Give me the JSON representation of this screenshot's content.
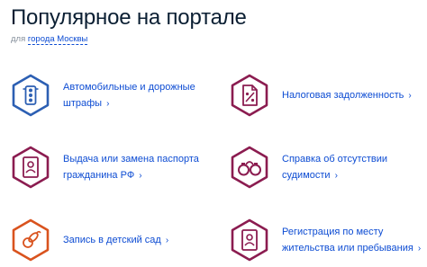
{
  "header": {
    "title": "Популярное на портале",
    "subtitle_prefix": "для",
    "city": "города Москвы"
  },
  "items": [
    {
      "line1": "Автомобильные и дорожные",
      "line2": "штрафы",
      "icon": "traffic-light-icon",
      "color": "#2c5fb3"
    },
    {
      "line1": "Налоговая задолженность",
      "line2": "",
      "icon": "tax-document-icon",
      "color": "#8b1c50"
    },
    {
      "line1": "Выдача или замена паспорта",
      "line2": "гражданина РФ",
      "icon": "passport-icon",
      "color": "#8b1c50"
    },
    {
      "line1": "Справка об отсутствии",
      "line2": "судимости",
      "icon": "handcuffs-icon",
      "color": "#8b1c50"
    },
    {
      "line1": "Запись в детский сад",
      "line2": "",
      "icon": "pacifier-icon",
      "color": "#d9531e"
    },
    {
      "line1": "Регистрация по месту",
      "line2": "жительства или пребывания",
      "icon": "id-card-icon",
      "color": "#8b1c50"
    }
  ],
  "chevron": "›"
}
